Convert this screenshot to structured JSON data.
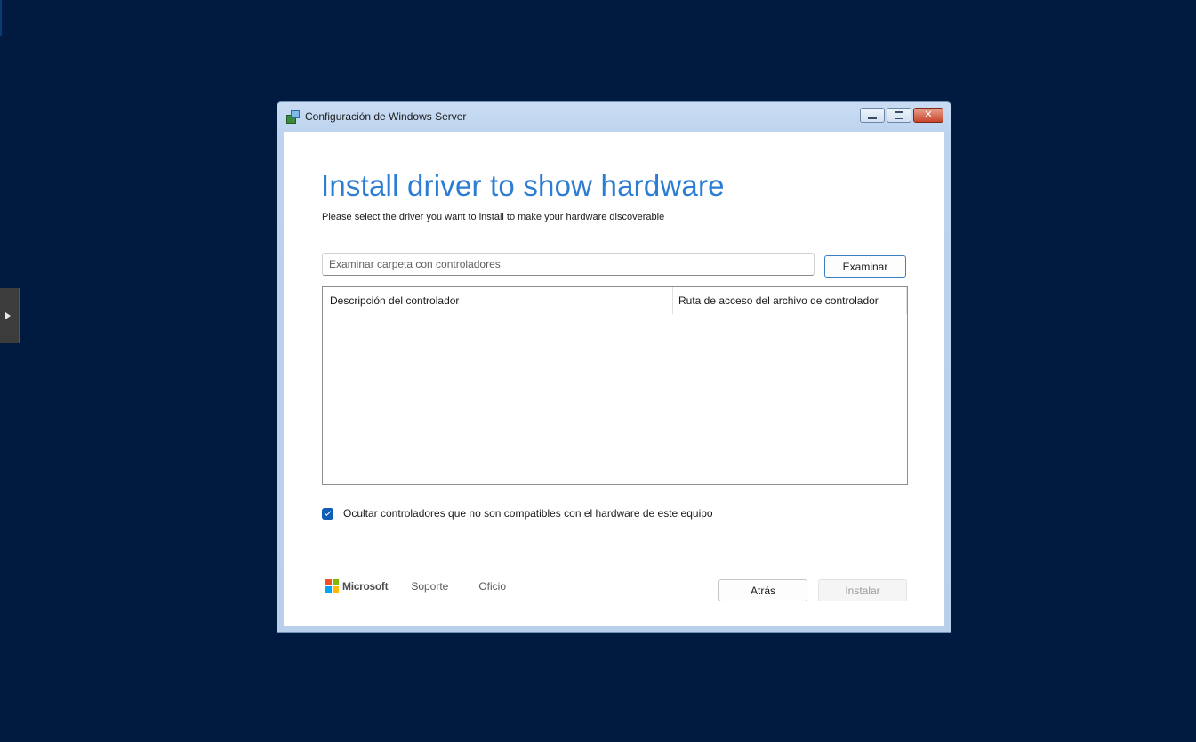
{
  "window": {
    "title": "Configuración de Windows Server"
  },
  "page": {
    "heading": "Install driver to show hardware",
    "subheading": "Please select the driver you want to install to make your hardware discoverable"
  },
  "browse": {
    "placeholder": "Examinar carpeta con controladores",
    "button_label": "Examinar"
  },
  "driver_table": {
    "columns": [
      "Descripción del controlador",
      "Ruta de acceso del archivo de controlador"
    ],
    "rows": []
  },
  "hide_incompatible": {
    "label": "Ocultar controladores que no son compatibles con el hardware de este equipo",
    "checked": true
  },
  "footer": {
    "brand": "Microsoft",
    "brand_colors": [
      "#f25022",
      "#7fba00",
      "#00a4ef",
      "#ffb900"
    ],
    "links": [
      "Soporte",
      "Oficio"
    ],
    "back_label": "Atrás",
    "install_label": "Instalar"
  },
  "colors": {
    "desktop_background": "#011a40",
    "accent": "#2b7cd3",
    "checkbox": "#0f5db5"
  }
}
